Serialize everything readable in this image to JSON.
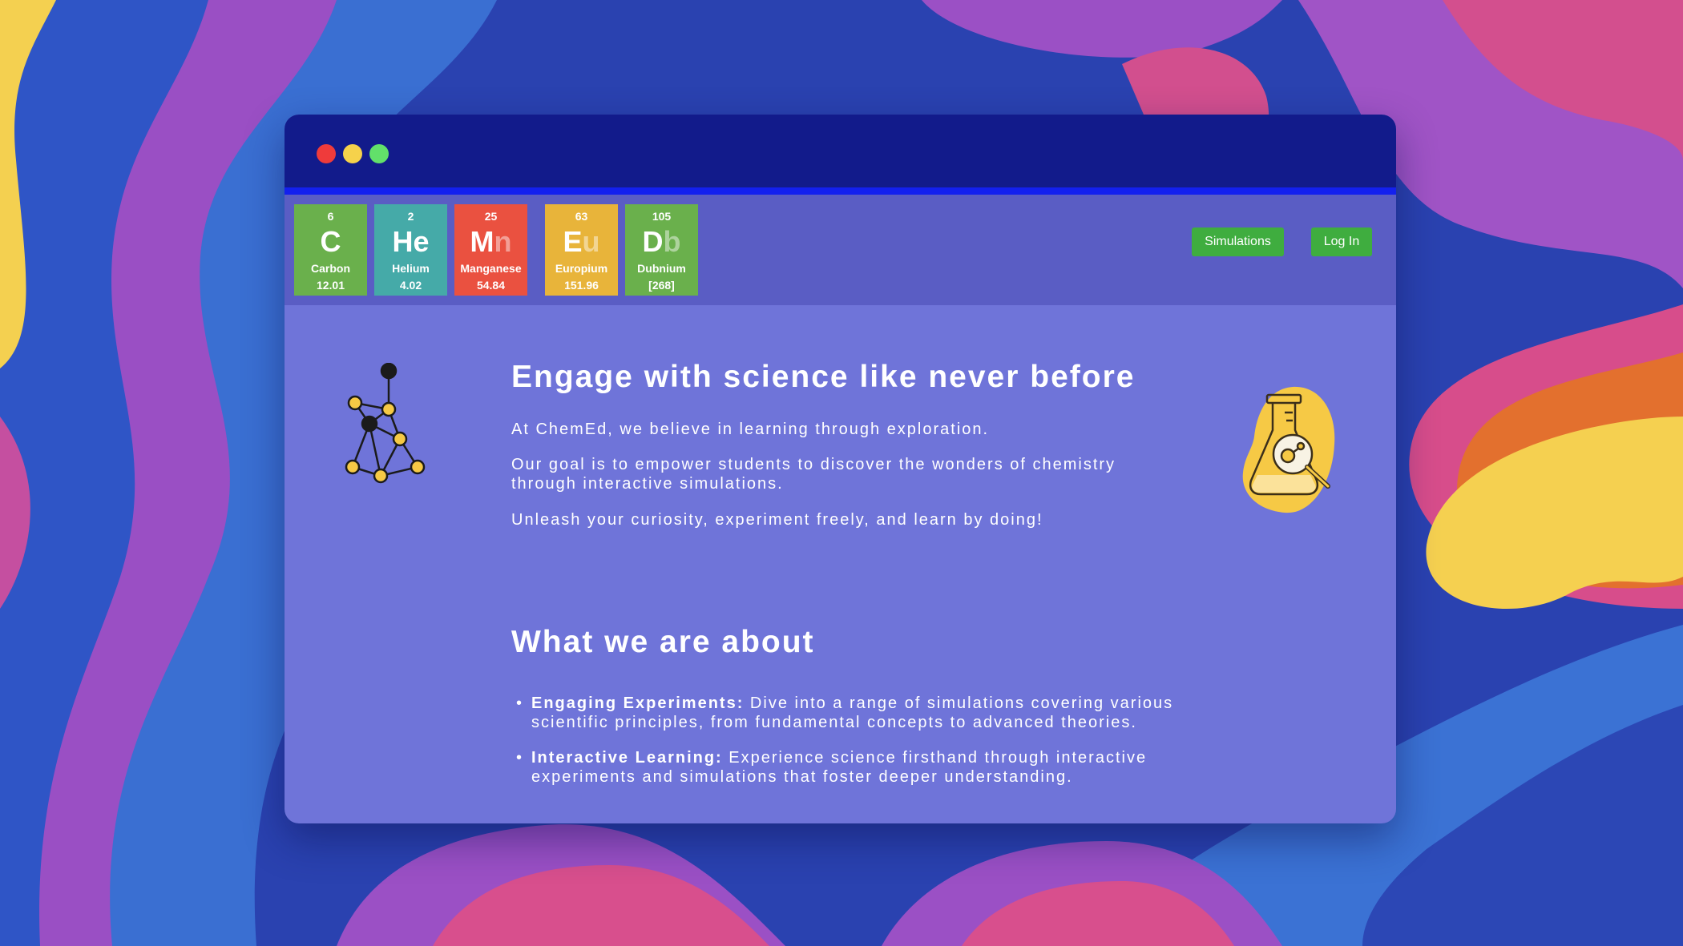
{
  "window": {
    "controls": [
      "close",
      "minimize",
      "maximize"
    ]
  },
  "elements": [
    {
      "number": "6",
      "symbol": "C",
      "symbol_faded": "",
      "name": "Carbon",
      "mass": "12.01",
      "color": "#6ab04c"
    },
    {
      "number": "2",
      "symbol": "He",
      "symbol_faded": "",
      "name": "Helium",
      "mass": "4.02",
      "color": "#45aaa8"
    },
    {
      "number": "25",
      "symbol": "M",
      "symbol_faded": "n",
      "name": "Manganese",
      "mass": "54.84",
      "color": "#ea5140"
    },
    {
      "number": "63",
      "symbol": "E",
      "symbol_faded": "u",
      "name": "Europium",
      "mass": "151.96",
      "color": "#e8b43a"
    },
    {
      "number": "105",
      "symbol": "D",
      "symbol_faded": "b",
      "name": "Dubnium",
      "mass": "[268]",
      "color": "#6ab04c"
    }
  ],
  "nav": {
    "simulations": "Simulations",
    "login": "Log In",
    "button_color": "#3fad3f"
  },
  "hero": {
    "title": "Engage with science like never before",
    "p1": "At ChemEd, we believe in learning through exploration.",
    "p2": "Our goal is to empower students to discover the wonders of chemistry through interactive simulations.",
    "p3": "Unleash your curiosity, experiment freely, and learn by doing!"
  },
  "about": {
    "title": "What we are about",
    "features": [
      {
        "label": "Engaging Experiments:",
        "text": " Dive into a range of simulations covering various scientific principles, from fundamental concepts to advanced theories."
      },
      {
        "label": "Interactive Learning:",
        "text": " Experience science firsthand through interactive experiments and simulations that foster deeper understanding."
      }
    ]
  },
  "icons": {
    "molecule": "molecule-icon",
    "flask": "flask-magnifier-icon"
  },
  "colors": {
    "content_bg": "#6f74d9",
    "navbar_bg": "#5a5dc4",
    "titlebar_bg": "#0c1685",
    "accent_yellow": "#f6c945"
  }
}
